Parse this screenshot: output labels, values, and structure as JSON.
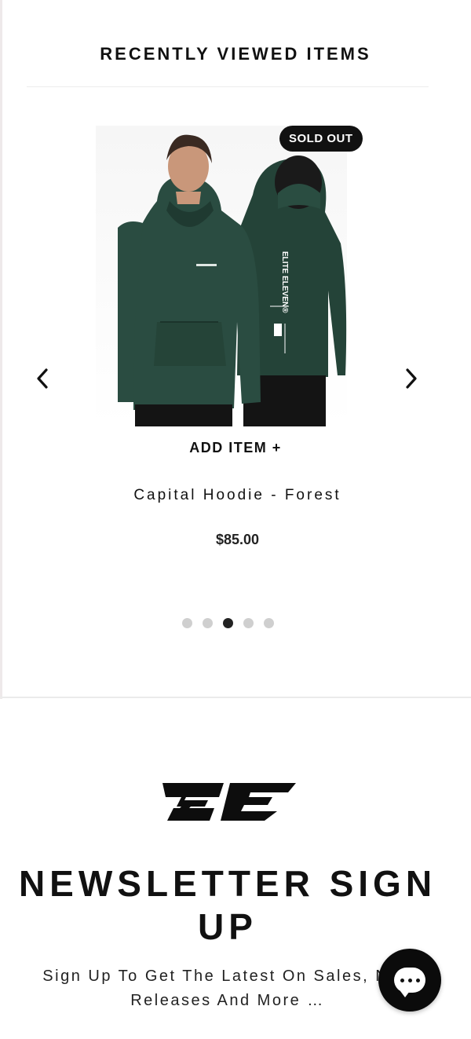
{
  "recently_viewed": {
    "title": "RECENTLY VIEWED ITEMS",
    "prev_icon": "chevron-left-icon",
    "next_icon": "chevron-right-icon",
    "product": {
      "badge": "SOLD OUT",
      "add_label": "ADD ITEM +",
      "name": "Capital Hoodie - Forest",
      "price": "$85.00",
      "print_text": "ELITE ELEVEN®",
      "color": "#264a3f"
    },
    "pagination": {
      "count": 5,
      "active_index": 2
    }
  },
  "newsletter": {
    "logo": "elite-eleven-logo",
    "title": "NEWSLETTER SIGN UP",
    "subtitle": "Sign Up To Get The Latest On Sales, New Releases And More …"
  },
  "chat": {
    "icon": "chat-bubble-icon"
  }
}
